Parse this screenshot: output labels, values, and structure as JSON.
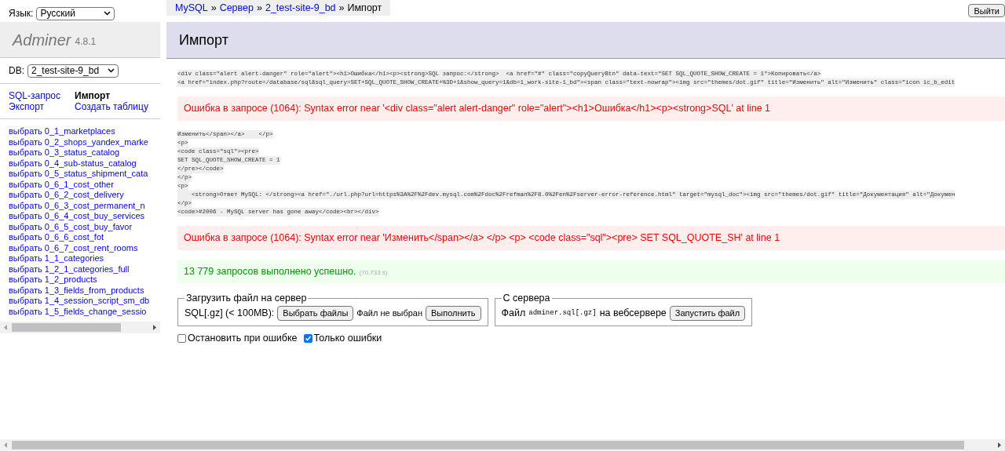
{
  "language": {
    "label": "Язык:",
    "value": "Русский"
  },
  "logo": {
    "name": "Adminer",
    "version": "4.8.1"
  },
  "db": {
    "label": "DB:",
    "value": "2_test-site-9_bd"
  },
  "nav_links": [
    {
      "label": "SQL-запрос",
      "selected": false
    },
    {
      "label": "Импорт",
      "selected": true
    },
    {
      "label": "Экспорт",
      "selected": false
    },
    {
      "label": "Создать таблицу",
      "selected": false
    }
  ],
  "tables": [
    {
      "action": "выбрать",
      "name": "0_1_marketplaces"
    },
    {
      "action": "выбрать",
      "name": "0_2_shops_yandex_marke"
    },
    {
      "action": "выбрать",
      "name": "0_3_status_catalog"
    },
    {
      "action": "выбрать",
      "name": "0_4_sub-status_catalog"
    },
    {
      "action": "выбрать",
      "name": "0_5_status_shipment_cata"
    },
    {
      "action": "выбрать",
      "name": "0_6_1_cost_other"
    },
    {
      "action": "выбрать",
      "name": "0_6_2_cost_delivery"
    },
    {
      "action": "выбрать",
      "name": "0_6_3_cost_permanent_n"
    },
    {
      "action": "выбрать",
      "name": "0_6_4_cost_buy_services"
    },
    {
      "action": "выбрать",
      "name": "0_6_5_cost_buy_favor"
    },
    {
      "action": "выбрать",
      "name": "0_6_6_cost_fot"
    },
    {
      "action": "выбрать",
      "name": "0_6_7_cost_rent_rooms"
    },
    {
      "action": "выбрать",
      "name": "1_1_categories"
    },
    {
      "action": "выбрать",
      "name": "1_2_1_categories_full"
    },
    {
      "action": "выбрать",
      "name": "1_2_products"
    },
    {
      "action": "выбрать",
      "name": "1_3_fields_from_products"
    },
    {
      "action": "выбрать",
      "name": "1_4_session_script_sm_db"
    },
    {
      "action": "выбрать",
      "name": "1_5_fields_change_sessio"
    }
  ],
  "breadcrumb": [
    {
      "label": "MySQL",
      "link": true
    },
    {
      "label": "Сервер",
      "link": true
    },
    {
      "label": "2_test-site-9_bd",
      "link": true
    },
    {
      "label": "Импорт",
      "link": false
    }
  ],
  "breadcrumb_separator": "»",
  "logout": "Выйти",
  "title": "Импорт",
  "messages": [
    {
      "kind": "code",
      "lines": [
        "<div class=\"alert alert-danger\" role=\"alert\"><h1>Ошибка</h1><p><strong>SQL запрос:</strong>  <a href=\"#\" class=\"copyQueryBtn\" data-text=\"SET SQL_QUOTE_SHOW_CREATE = 1\">Копировать</a>",
        "<a href=\"index.php?route=/database/sql&sql_query=SET+SQL_QUOTE_SHOW_CREATE+%3D+1&show_query=1&db=1_work-site-1_bd\"><span class=\"text-nowrap\"><img src=\"themes/dot.gif\" title=\"Изменить\" alt=\"Изменить\" class=\"icon ic_b_edit"
      ]
    },
    {
      "kind": "error",
      "text": "Ошибка в запросе (1064): Syntax error near '<div class=\"alert alert-danger\" role=\"alert\"><h1>Ошибка</h1><p><strong>SQL' at line 1"
    },
    {
      "kind": "code",
      "lines": [
        "Изменить</span></a>    </p>",
        "<p>",
        "<code class=\"sql\"><pre>",
        "SET SQL_QUOTE_SHOW_CREATE = 1",
        "</pre></code>",
        "</p>",
        "<p>",
        "    <strong>Ответ MySQL: </strong><a href=\"./url.php?url=https%3A%2F%2Fdev.mysql.com%2Fdoc%2Frefman%2F8.0%2Fen%2Fserver-error-reference.html\" target=\"mysql_doc\"><img src=\"themes/dot.gif\" title=\"Документация\" alt=\"Докумен",
        "</p>",
        "<code>#2006 - MySQL server has gone away</code><br></div>"
      ]
    },
    {
      "kind": "error",
      "text": "Ошибка в запросе (1064): Syntax error near 'Изменить</span></a> </p> <p> <code class=\"sql\"><pre> SET SQL_QUOTE_SH' at line 1"
    },
    {
      "kind": "success",
      "text": "13 779 запросов выполнено успешно.",
      "time": "(70.733 s)"
    }
  ],
  "upload": {
    "legend": "Загрузить файл на сервер",
    "label": "SQL[.gz] (< 100MB):",
    "choose": "Выбрать файлы",
    "no_file": "Файл не выбран",
    "run": "Выполнить"
  },
  "server": {
    "legend": "С сервера",
    "prefix": "Файл",
    "file": "adminer.sql[.gz]",
    "suffix": "на вебсервере",
    "run": "Запустить файл"
  },
  "options": [
    {
      "label": "Остановить при ошибке",
      "checked": false
    },
    {
      "label": "Только ошибки",
      "checked": true
    }
  ]
}
